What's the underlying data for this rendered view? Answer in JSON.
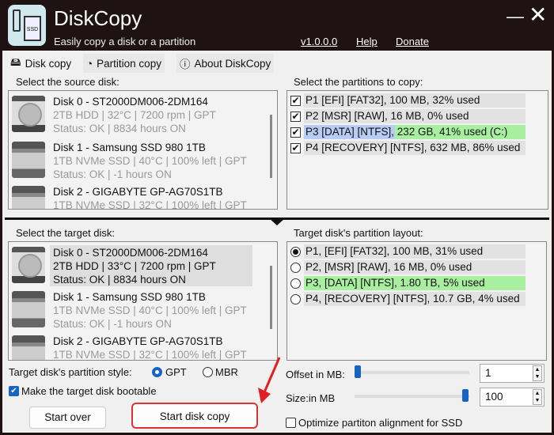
{
  "app": {
    "title": "DiskCopy",
    "subtitle": "Easily copy a disk or a partition",
    "version": "v1.0.0.0",
    "help": "Help",
    "donate": "Donate",
    "minimize": "—",
    "close": "✕"
  },
  "tabs": [
    {
      "label": "Disk copy",
      "icon": "drive-icon",
      "active": true
    },
    {
      "label": "Partition copy",
      "icon": "partition-icon"
    },
    {
      "label": "About DiskCopy",
      "icon": "info-icon"
    }
  ],
  "source": {
    "label": "Select the source disk:",
    "disks": [
      {
        "name": "Disk 0 - ST2000DM006-2DM164",
        "details": "2TB HDD | 32°C | 7200 rpm | GPT",
        "status": "Status: OK | 8834 hours ON",
        "type": "hdd"
      },
      {
        "name": "Disk 1 - Samsung SSD 980 1TB",
        "details": "1TB NVMe SSD | 40°C | 100% left | GPT",
        "status": "Status: OK | -1 hours ON",
        "type": "ssd"
      },
      {
        "name": "Disk 2 - GIGABYTE GP-AG70S1TB",
        "details": "1TB NVMe SSD | 32°C | 100% left | GPT",
        "type": "ssd"
      }
    ]
  },
  "partitions": {
    "label": "Select the partitions to copy:",
    "items": [
      {
        "label": "P1 [EFI] [FAT32], 100 MB, 32% used",
        "checked": true
      },
      {
        "label": "P2 [MSR] [RAW], 16 MB, 0% used",
        "checked": true
      },
      {
        "label": "P3 [DATA] [NTFS], 232 GB, 41% used (C:)",
        "checked": true,
        "used_pct": 41,
        "highlight": "#a8f0a0"
      },
      {
        "label": "P4 [RECOVERY] [NTFS], 632 MB, 86% used",
        "checked": true
      }
    ]
  },
  "target": {
    "label": "Select the target disk:",
    "disks": [
      {
        "name": "Disk 0 - ST2000DM006-2DM164",
        "details": "2TB HDD | 33°C | 7200 rpm | GPT",
        "status": "Status: OK | 8834 hours ON",
        "type": "hdd",
        "selected": true
      },
      {
        "name": "Disk 1 - Samsung SSD 980 1TB",
        "details": "1TB NVMe SSD | 40°C | 100% left | GPT",
        "status": "Status: OK | -1 hours ON",
        "type": "ssd"
      },
      {
        "name": "Disk 2 - GIGABYTE GP-AG70S1TB",
        "details": "1TB NVMe SSD | 32°C | 100% left | GPT",
        "type": "ssd"
      }
    ]
  },
  "layout": {
    "label": "Target disk's partition layout:",
    "items": [
      {
        "label": "P1, [EFI] [FAT32], 100 MB, 31% used",
        "selected": true
      },
      {
        "label": "P2, [MSR] [RAW], 16 MB, 0% used"
      },
      {
        "label": "P3, [DATA] [NTFS], 1.80 TB, 5% used",
        "highlight": "#a8f0a0"
      },
      {
        "label": "P4, [RECOVERY] [NTFS], 10.7 GB, 4% used"
      }
    ]
  },
  "options": {
    "style_label": "Target disk's partition style:",
    "gpt": "GPT",
    "mbr": "MBR",
    "style_selected": "GPT",
    "bootable": "Make the target disk bootable",
    "bootable_checked": true,
    "offset_label": "Offset in MB:",
    "offset_value": "1",
    "size_label": "Size:in MB",
    "size_value": "100",
    "optimize": "Optimize partiton alignment for SSD",
    "optimize_checked": false
  },
  "buttons": {
    "start_over": "Start over",
    "start_copy": "Start disk copy"
  },
  "colors": {
    "accent": "#1565c0",
    "annotation": "#e02020"
  }
}
